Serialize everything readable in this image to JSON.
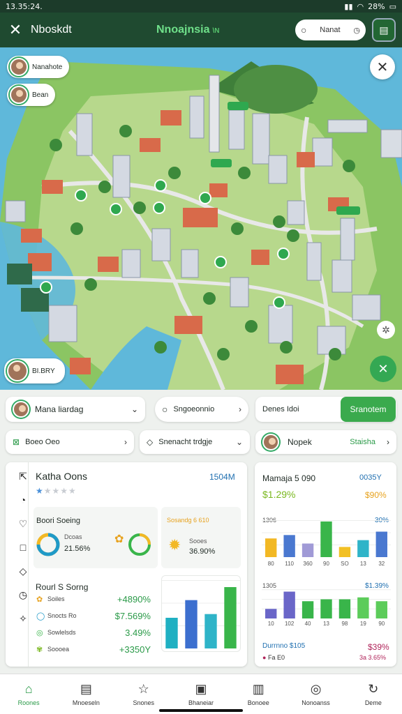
{
  "status": {
    "time": "13.35:24.",
    "battery": "28%"
  },
  "topbar": {
    "title": "Nboskdt",
    "center": "Nnoajnsia",
    "center_suffix": "\\N",
    "search": "Nanat"
  },
  "map_chips": {
    "user1": "Nanahote",
    "user2": "Bean",
    "user3": "BI.BRY"
  },
  "filters": {
    "user_select": "Mana liardag",
    "search": "Sngoeonnio",
    "dates": "Denes Idoi",
    "apply": "Sranotem",
    "chip1": "Boeo Oeo",
    "chip2": "Snenacht trdgje",
    "person": "Nopek",
    "person_tag": "Staisha"
  },
  "left_card": {
    "title": "Katha Oons",
    "value": "1504M",
    "stars": 1,
    "section1": "Boori Soeing",
    "gauge_label": "Dcoas",
    "gauge_value": "21.56%",
    "section1b": "Sosandg 6 610",
    "sun_label": "Sooes",
    "sun_value": "36.90%",
    "section2": "Rourl S Sorng",
    "list": [
      {
        "label": "Soiles",
        "value": "+4890%"
      },
      {
        "label": "Snocts Ro",
        "value": "$7.569%"
      },
      {
        "label": "Sowlelsds",
        "value": "3.49%"
      },
      {
        "label": "Soooea",
        "value": "+3350Y"
      }
    ]
  },
  "right_card": {
    "title": "Mamaja 5 090",
    "value": "0035Y",
    "pct_left": "$1.29%",
    "pct_right": "$90%",
    "chart1_label": "1306",
    "chart1_pct": "30%",
    "chart2_label": "1305",
    "chart2_pct": "$1.39%",
    "footer_left": "Durrnno $105",
    "footer_right": "$39%",
    "footer_sub_left": "Fa E0",
    "footer_sub_right": "3a 3.65%"
  },
  "chart_data": [
    {
      "type": "bar",
      "categories": [
        "80",
        "110",
        "360",
        "90",
        "SO",
        "13",
        "32"
      ],
      "series": [
        {
          "values": [
            22,
            26,
            16,
            42,
            12,
            20,
            30
          ]
        }
      ],
      "colors": [
        "#f2b824",
        "#4a78d0",
        "#a09ad6",
        "#39b54a",
        "#f2c024",
        "#2fb4c8",
        "#4a78d0"
      ]
    },
    {
      "type": "bar",
      "categories": [
        "10",
        "102",
        "40",
        "13",
        "98",
        "19",
        "90"
      ],
      "series": [
        {
          "values": [
            10,
            28,
            18,
            20,
            20,
            22,
            18
          ]
        }
      ],
      "colors": [
        "#6a66c8",
        "#6a66c8",
        "#39b54a",
        "#39b54a",
        "#39b54a",
        "#5ccc5a",
        "#5ccc5a"
      ]
    },
    {
      "type": "bar",
      "categories": [],
      "series": [
        {
          "values": [
            33,
            52,
            37,
            66
          ]
        }
      ],
      "colors": [
        "#1fb0c2",
        "#3c6fcf",
        "#2fb4c8",
        "#39b54a"
      ]
    }
  ],
  "nav": [
    {
      "label": "Roones",
      "icon": "home-icon",
      "active": true
    },
    {
      "label": "Mnoeseln",
      "icon": "document-icon",
      "active": false
    },
    {
      "label": "Snones",
      "icon": "star-icon",
      "active": false
    },
    {
      "label": "Bhaneiar",
      "icon": "wallet-icon",
      "active": false
    },
    {
      "label": "Bonoee",
      "icon": "building-icon",
      "active": false
    },
    {
      "label": "Nonoanss",
      "icon": "chat-icon",
      "active": false
    },
    {
      "label": "Deme",
      "icon": "refresh-icon",
      "active": false
    }
  ]
}
